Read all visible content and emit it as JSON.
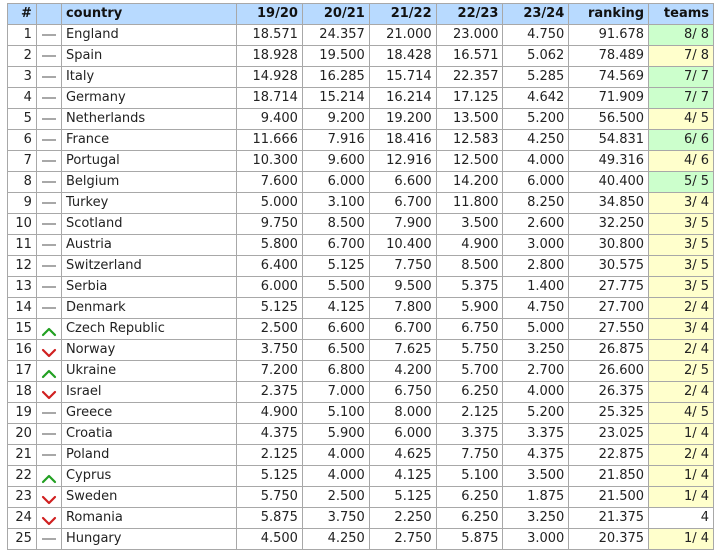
{
  "colors": {
    "header_bg": "#b8daff",
    "teams_full_bg": "#ccffcc",
    "teams_partial_bg": "#ffffcc",
    "trend_up": "#22a022",
    "trend_down": "#d02020",
    "trend_same": "#a8a8a8"
  },
  "header": {
    "pos": "#",
    "trend": "",
    "country": "country",
    "s1920": "19/20",
    "s2021": "20/21",
    "s2122": "21/22",
    "s2223": "22/23",
    "s2324": "23/24",
    "ranking": "ranking",
    "teams": "teams"
  },
  "rows": [
    {
      "pos": "1",
      "trend": "same",
      "trend_icon": "dash-icon",
      "country": "England",
      "s1920": "18.571",
      "s2021": "24.357",
      "s2122": "21.000",
      "s2223": "23.000",
      "s2324": "4.750",
      "ranking": "91.678",
      "teams": "8/ 8",
      "teams_status": "full"
    },
    {
      "pos": "2",
      "trend": "same",
      "trend_icon": "dash-icon",
      "country": "Spain",
      "s1920": "18.928",
      "s2021": "19.500",
      "s2122": "18.428",
      "s2223": "16.571",
      "s2324": "5.062",
      "ranking": "78.489",
      "teams": "7/ 8",
      "teams_status": "partial"
    },
    {
      "pos": "3",
      "trend": "same",
      "trend_icon": "dash-icon",
      "country": "Italy",
      "s1920": "14.928",
      "s2021": "16.285",
      "s2122": "15.714",
      "s2223": "22.357",
      "s2324": "5.285",
      "ranking": "74.569",
      "teams": "7/ 7",
      "teams_status": "full"
    },
    {
      "pos": "4",
      "trend": "same",
      "trend_icon": "dash-icon",
      "country": "Germany",
      "s1920": "18.714",
      "s2021": "15.214",
      "s2122": "16.214",
      "s2223": "17.125",
      "s2324": "4.642",
      "ranking": "71.909",
      "teams": "7/ 7",
      "teams_status": "full"
    },
    {
      "pos": "5",
      "trend": "same",
      "trend_icon": "dash-icon",
      "country": "Netherlands",
      "s1920": "9.400",
      "s2021": "9.200",
      "s2122": "19.200",
      "s2223": "13.500",
      "s2324": "5.200",
      "ranking": "56.500",
      "teams": "4/ 5",
      "teams_status": "partial"
    },
    {
      "pos": "6",
      "trend": "same",
      "trend_icon": "dash-icon",
      "country": "France",
      "s1920": "11.666",
      "s2021": "7.916",
      "s2122": "18.416",
      "s2223": "12.583",
      "s2324": "4.250",
      "ranking": "54.831",
      "teams": "6/ 6",
      "teams_status": "full"
    },
    {
      "pos": "7",
      "trend": "same",
      "trend_icon": "dash-icon",
      "country": "Portugal",
      "s1920": "10.300",
      "s2021": "9.600",
      "s2122": "12.916",
      "s2223": "12.500",
      "s2324": "4.000",
      "ranking": "49.316",
      "teams": "4/ 6",
      "teams_status": "partial"
    },
    {
      "pos": "8",
      "trend": "same",
      "trend_icon": "dash-icon",
      "country": "Belgium",
      "s1920": "7.600",
      "s2021": "6.000",
      "s2122": "6.600",
      "s2223": "14.200",
      "s2324": "6.000",
      "ranking": "40.400",
      "teams": "5/ 5",
      "teams_status": "full"
    },
    {
      "pos": "9",
      "trend": "same",
      "trend_icon": "dash-icon",
      "country": "Turkey",
      "s1920": "5.000",
      "s2021": "3.100",
      "s2122": "6.700",
      "s2223": "11.800",
      "s2324": "8.250",
      "ranking": "34.850",
      "teams": "3/ 4",
      "teams_status": "partial"
    },
    {
      "pos": "10",
      "trend": "same",
      "trend_icon": "dash-icon",
      "country": "Scotland",
      "s1920": "9.750",
      "s2021": "8.500",
      "s2122": "7.900",
      "s2223": "3.500",
      "s2324": "2.600",
      "ranking": "32.250",
      "teams": "3/ 5",
      "teams_status": "partial"
    },
    {
      "pos": "11",
      "trend": "same",
      "trend_icon": "dash-icon",
      "country": "Austria",
      "s1920": "5.800",
      "s2021": "6.700",
      "s2122": "10.400",
      "s2223": "4.900",
      "s2324": "3.000",
      "ranking": "30.800",
      "teams": "3/ 5",
      "teams_status": "partial"
    },
    {
      "pos": "12",
      "trend": "same",
      "trend_icon": "dash-icon",
      "country": "Switzerland",
      "s1920": "6.400",
      "s2021": "5.125",
      "s2122": "7.750",
      "s2223": "8.500",
      "s2324": "2.800",
      "ranking": "30.575",
      "teams": "3/ 5",
      "teams_status": "partial"
    },
    {
      "pos": "13",
      "trend": "same",
      "trend_icon": "dash-icon",
      "country": "Serbia",
      "s1920": "6.000",
      "s2021": "5.500",
      "s2122": "9.500",
      "s2223": "5.375",
      "s2324": "1.400",
      "ranking": "27.775",
      "teams": "3/ 5",
      "teams_status": "partial"
    },
    {
      "pos": "14",
      "trend": "same",
      "trend_icon": "dash-icon",
      "country": "Denmark",
      "s1920": "5.125",
      "s2021": "4.125",
      "s2122": "7.800",
      "s2223": "5.900",
      "s2324": "4.750",
      "ranking": "27.700",
      "teams": "2/ 4",
      "teams_status": "partial"
    },
    {
      "pos": "15",
      "trend": "up",
      "trend_icon": "chevron-up-icon",
      "country": "Czech Republic",
      "s1920": "2.500",
      "s2021": "6.600",
      "s2122": "6.700",
      "s2223": "6.750",
      "s2324": "5.000",
      "ranking": "27.550",
      "teams": "3/ 4",
      "teams_status": "partial"
    },
    {
      "pos": "16",
      "trend": "down",
      "trend_icon": "chevron-down-icon",
      "country": "Norway",
      "s1920": "3.750",
      "s2021": "6.500",
      "s2122": "7.625",
      "s2223": "5.750",
      "s2324": "3.250",
      "ranking": "26.875",
      "teams": "2/ 4",
      "teams_status": "partial"
    },
    {
      "pos": "17",
      "trend": "up",
      "trend_icon": "chevron-up-icon",
      "country": "Ukraine",
      "s1920": "7.200",
      "s2021": "6.800",
      "s2122": "4.200",
      "s2223": "5.700",
      "s2324": "2.700",
      "ranking": "26.600",
      "teams": "2/ 5",
      "teams_status": "partial"
    },
    {
      "pos": "18",
      "trend": "down",
      "trend_icon": "chevron-down-icon",
      "country": "Israel",
      "s1920": "2.375",
      "s2021": "7.000",
      "s2122": "6.750",
      "s2223": "6.250",
      "s2324": "4.000",
      "ranking": "26.375",
      "teams": "2/ 4",
      "teams_status": "partial"
    },
    {
      "pos": "19",
      "trend": "same",
      "trend_icon": "dash-icon",
      "country": "Greece",
      "s1920": "4.900",
      "s2021": "5.100",
      "s2122": "8.000",
      "s2223": "2.125",
      "s2324": "5.200",
      "ranking": "25.325",
      "teams": "4/ 5",
      "teams_status": "partial"
    },
    {
      "pos": "20",
      "trend": "same",
      "trend_icon": "dash-icon",
      "country": "Croatia",
      "s1920": "4.375",
      "s2021": "5.900",
      "s2122": "6.000",
      "s2223": "3.375",
      "s2324": "3.375",
      "ranking": "23.025",
      "teams": "1/ 4",
      "teams_status": "partial"
    },
    {
      "pos": "21",
      "trend": "same",
      "trend_icon": "dash-icon",
      "country": "Poland",
      "s1920": "2.125",
      "s2021": "4.000",
      "s2122": "4.625",
      "s2223": "7.750",
      "s2324": "4.375",
      "ranking": "22.875",
      "teams": "2/ 4",
      "teams_status": "partial"
    },
    {
      "pos": "22",
      "trend": "up",
      "trend_icon": "chevron-up-icon",
      "country": "Cyprus",
      "s1920": "5.125",
      "s2021": "4.000",
      "s2122": "4.125",
      "s2223": "5.100",
      "s2324": "3.500",
      "ranking": "21.850",
      "teams": "1/ 4",
      "teams_status": "partial"
    },
    {
      "pos": "23",
      "trend": "down",
      "trend_icon": "chevron-down-icon",
      "country": "Sweden",
      "s1920": "5.750",
      "s2021": "2.500",
      "s2122": "5.125",
      "s2223": "6.250",
      "s2324": "1.875",
      "ranking": "21.500",
      "teams": "1/ 4",
      "teams_status": "partial"
    },
    {
      "pos": "24",
      "trend": "down",
      "trend_icon": "chevron-down-icon",
      "country": "Romania",
      "s1920": "5.875",
      "s2021": "3.750",
      "s2122": "2.250",
      "s2223": "6.250",
      "s2324": "3.250",
      "ranking": "21.375",
      "teams": "4",
      "teams_status": "none"
    },
    {
      "pos": "25",
      "trend": "same",
      "trend_icon": "dash-icon",
      "country": "Hungary",
      "s1920": "4.500",
      "s2021": "4.250",
      "s2122": "2.750",
      "s2223": "5.875",
      "s2324": "3.000",
      "ranking": "20.375",
      "teams": "1/ 4",
      "teams_status": "partial"
    }
  ]
}
